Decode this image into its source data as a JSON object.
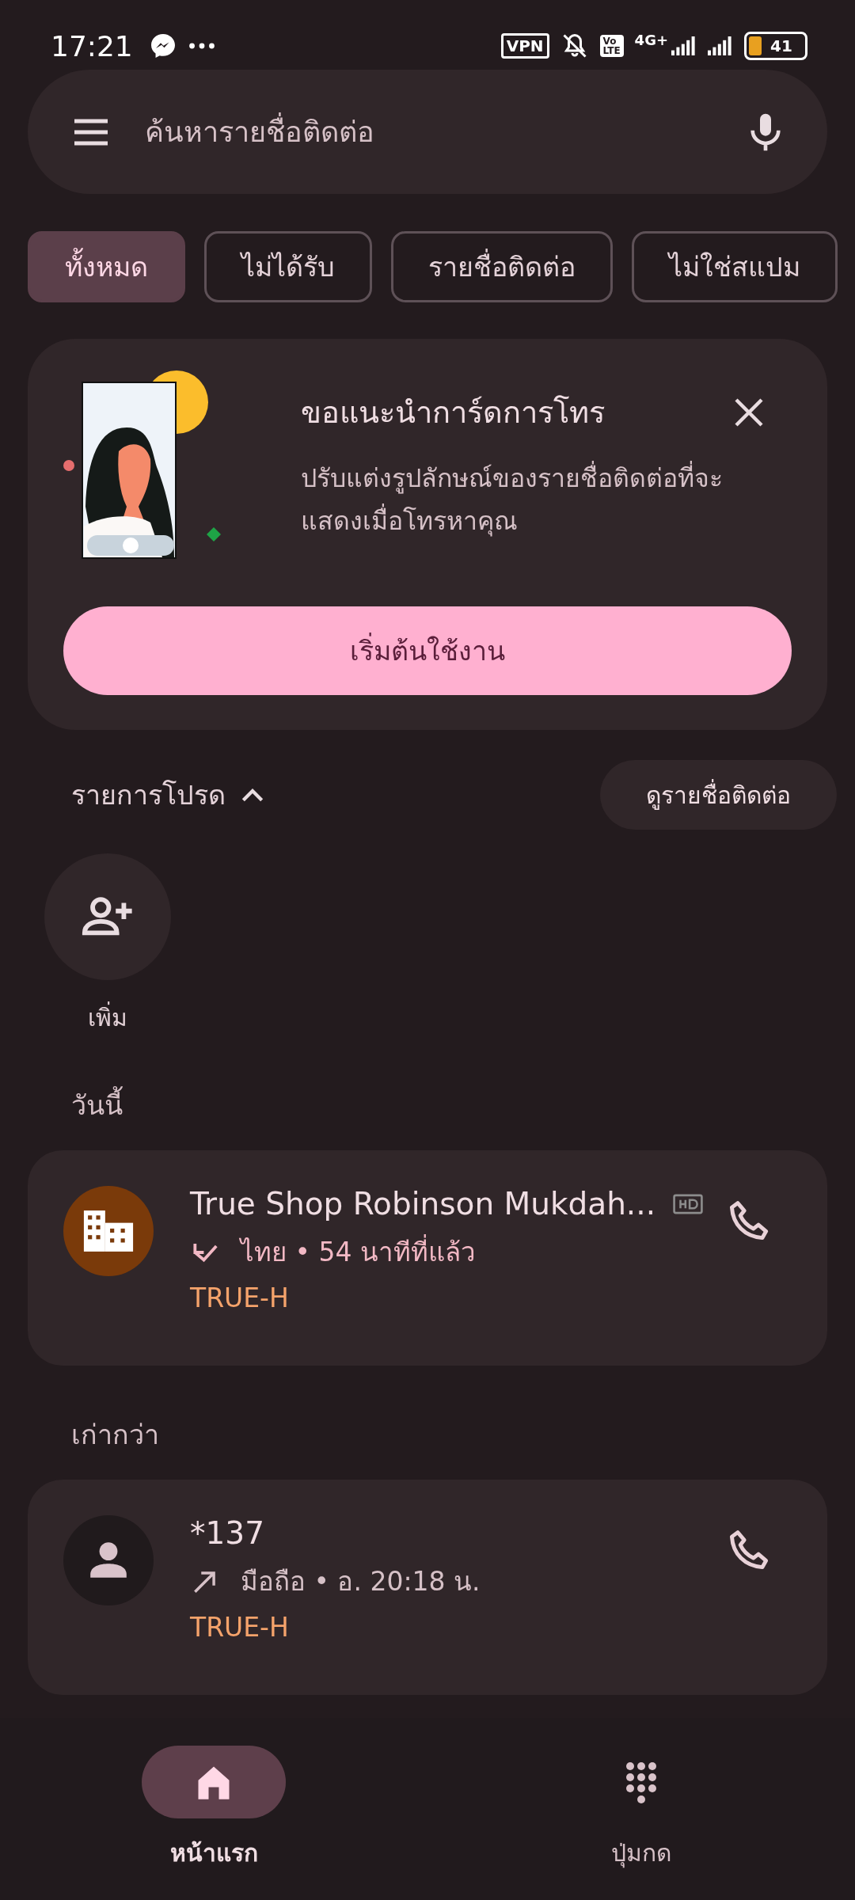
{
  "status_bar": {
    "time": "17:21",
    "vpn_label": "VPN",
    "volte_label": [
      "Vo",
      "LTE"
    ],
    "network_label": "4G+",
    "battery_text": "41"
  },
  "search": {
    "placeholder": "ค้นหารายชื่อติดต่อ"
  },
  "chips": [
    {
      "label": "ทั้งหมด",
      "selected": true
    },
    {
      "label": "ไม่ได้รับ",
      "selected": false
    },
    {
      "label": "รายชื่อติดต่อ",
      "selected": false
    },
    {
      "label": "ไม่ใช่สแปม",
      "selected": false
    }
  ],
  "promo_card": {
    "title": "ขอแนะนำการ์ดการโทร",
    "description": "ปรับแต่งรูปลักษณ์ของรายชื่อติดต่อที่จะแสดงเมื่อโทรหาคุณ",
    "button": "เริ่มต้นใช้งาน"
  },
  "favorites": {
    "title": "รายการโปรด",
    "expanded": true,
    "view_contacts_button": "ดูรายชื่อติดต่อ",
    "add_label": "เพิ่ม"
  },
  "call_groups": [
    {
      "title": "วันนี้",
      "calls": [
        {
          "avatar": {
            "kind": "business"
          },
          "name": "True Shop Robinson Mukdah...",
          "hd": true,
          "direction_icon": {
            "kind": "incoming"
          },
          "highlighted": true,
          "detail": "ไทย • 54 นาทีที่แล้ว",
          "carrier": "TRUE-H"
        }
      ]
    },
    {
      "title": "เก่ากว่า",
      "calls": [
        {
          "avatar": {
            "kind": "person"
          },
          "name": "*137",
          "hd": false,
          "direction_icon": {
            "kind": "outgoing"
          },
          "highlighted": false,
          "detail": "มือถือ • อ. 20:18 น.",
          "carrier": "TRUE-H"
        }
      ]
    }
  ],
  "nav": [
    {
      "kind": "home",
      "label": "หน้าแรก",
      "selected": true
    },
    {
      "kind": "dialpad",
      "label": "ปุ่มกด",
      "selected": false
    }
  ]
}
